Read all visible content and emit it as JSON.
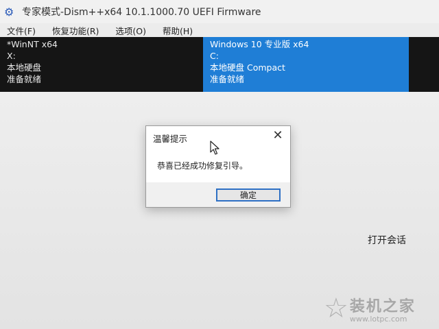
{
  "window": {
    "title": "专家模式-Dism++x64 10.1.1000.70 UEFI Firmware",
    "icon": "gear-icon"
  },
  "menu": {
    "items": [
      {
        "label": "文件(F)"
      },
      {
        "label": "恢复功能(R)"
      },
      {
        "label": "选项(O)"
      },
      {
        "label": "帮助(H)"
      }
    ]
  },
  "sessions": [
    {
      "name": "*WinNT x64",
      "drive": "X:",
      "disk": "本地硬盘",
      "status": "准备就绪",
      "selected": false
    },
    {
      "name": "Windows 10 专业版 x64",
      "drive": "C:",
      "disk": "本地硬盘 Compact",
      "status": "准备就绪",
      "selected": true
    }
  ],
  "main": {
    "open_session": "打开会话"
  },
  "dialog": {
    "title": "温馨提示",
    "message": "恭喜已经成功修复引导。",
    "ok_label": "确定"
  },
  "watermark": {
    "brand": "装机之家",
    "url": "www.lotpc.com"
  },
  "colors": {
    "accent": "#1f7ed6",
    "session_bg": "#151515"
  }
}
